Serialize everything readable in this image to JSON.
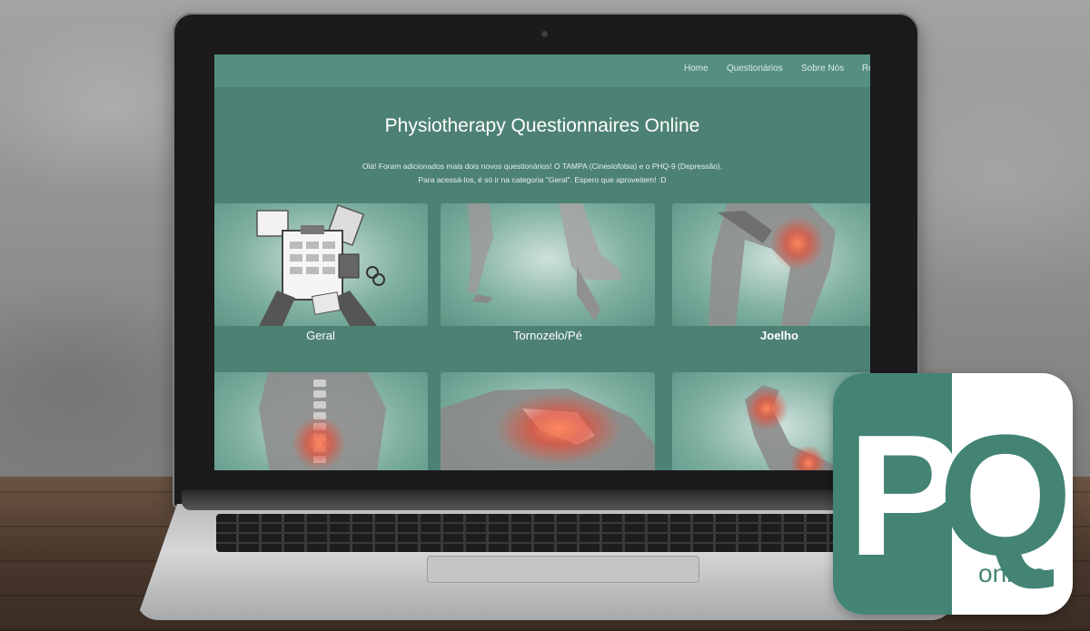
{
  "nav": {
    "items": [
      "Home",
      "Questionários",
      "Sobre Nós",
      "Re"
    ]
  },
  "hero": {
    "title": "Physiotherapy Questionnaires Online",
    "notice_line1": "Olá! Foram adicionados mais dois novos questionários! O TAMPA (Cinesiofobia) e o PHQ-9 (Depressão).",
    "notice_line2": "Para acessá-los, é só ir na categoria \"Geral\". Espero que aproveitem! :D"
  },
  "categories": [
    {
      "label": "Geral",
      "icon": "paperwork-icon"
    },
    {
      "label": "Tornozelo/Pé",
      "icon": "ankle-foot-icon"
    },
    {
      "label": "Joelho",
      "icon": "knee-icon"
    },
    {
      "label": "",
      "icon": "spine-icon"
    },
    {
      "label": "",
      "icon": "shoulder-icon"
    },
    {
      "label": "",
      "icon": "wrist-icon"
    }
  ],
  "logo": {
    "letter1": "P",
    "letter2": "Q",
    "tagline": "online"
  },
  "colors": {
    "brand": "#438474",
    "navbar": "#558f80",
    "page": "#4d8173",
    "highlight": "#e84a32"
  }
}
